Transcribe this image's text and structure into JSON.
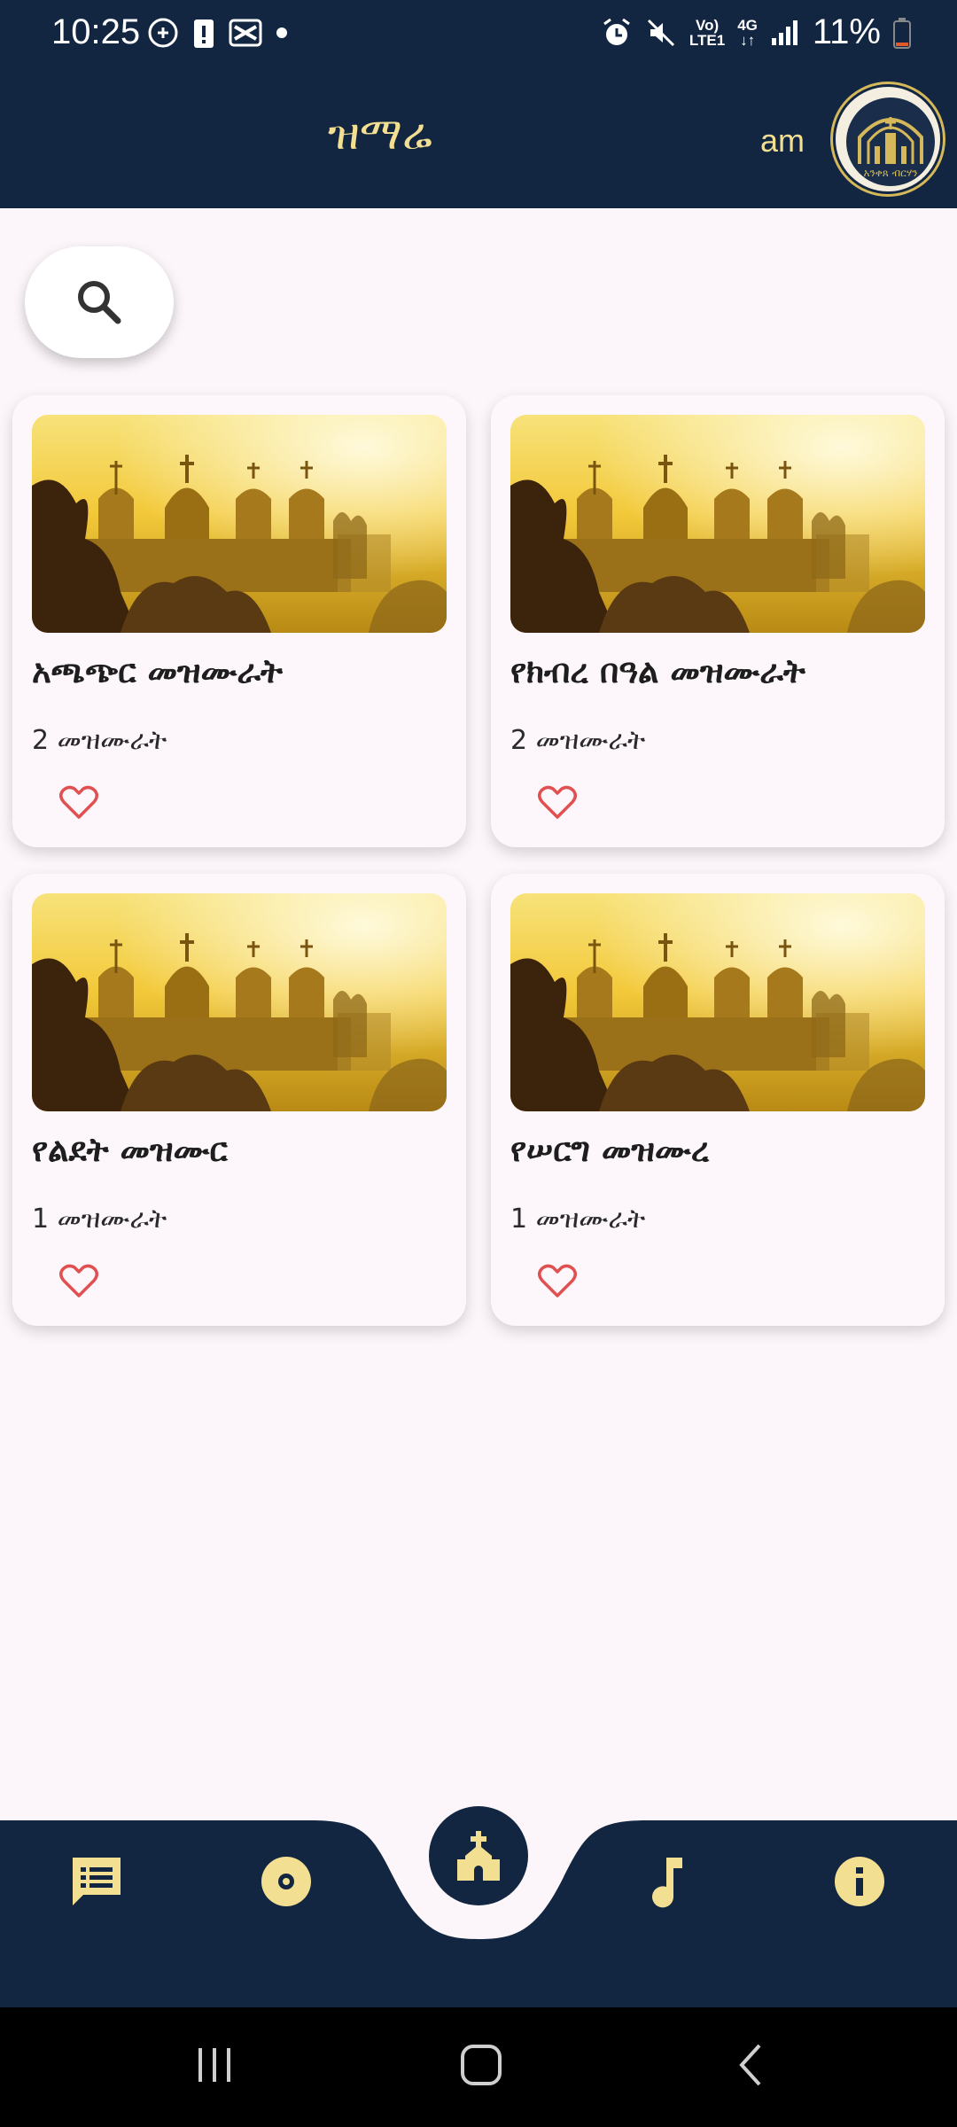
{
  "status_bar": {
    "time": "10:25",
    "network_top": "Vo)",
    "network_bottom": "LTE1",
    "gen": "4G",
    "battery": "11%"
  },
  "app_bar": {
    "title": "ዝማሬ",
    "language": "am",
    "logo_text": "አንቀጸ ብርሃን"
  },
  "search": {
    "icon": "search-icon"
  },
  "cards": [
    {
      "title": "አጫጭር መዝሙራት",
      "count": "2 መዝሙራት"
    },
    {
      "title": "የክብረ በዓል መዝሙራት",
      "count": "2 መዝሙራት"
    },
    {
      "title": "የልደት መዝሙር",
      "count": "1 መዝሙራት"
    },
    {
      "title": "የሠርግ መዝሙረ",
      "count": "1 መዝሙራት"
    }
  ],
  "bottom_nav": {
    "items": [
      "chat-list-icon",
      "disc-icon",
      "church-icon",
      "music-note-icon",
      "info-icon"
    ],
    "accent": "#f3df91",
    "background": "#122641"
  },
  "colors": {
    "header": "#122641",
    "accent": "#f3df91",
    "heart": "#e05050",
    "page_bg": "#fcf6fa"
  }
}
